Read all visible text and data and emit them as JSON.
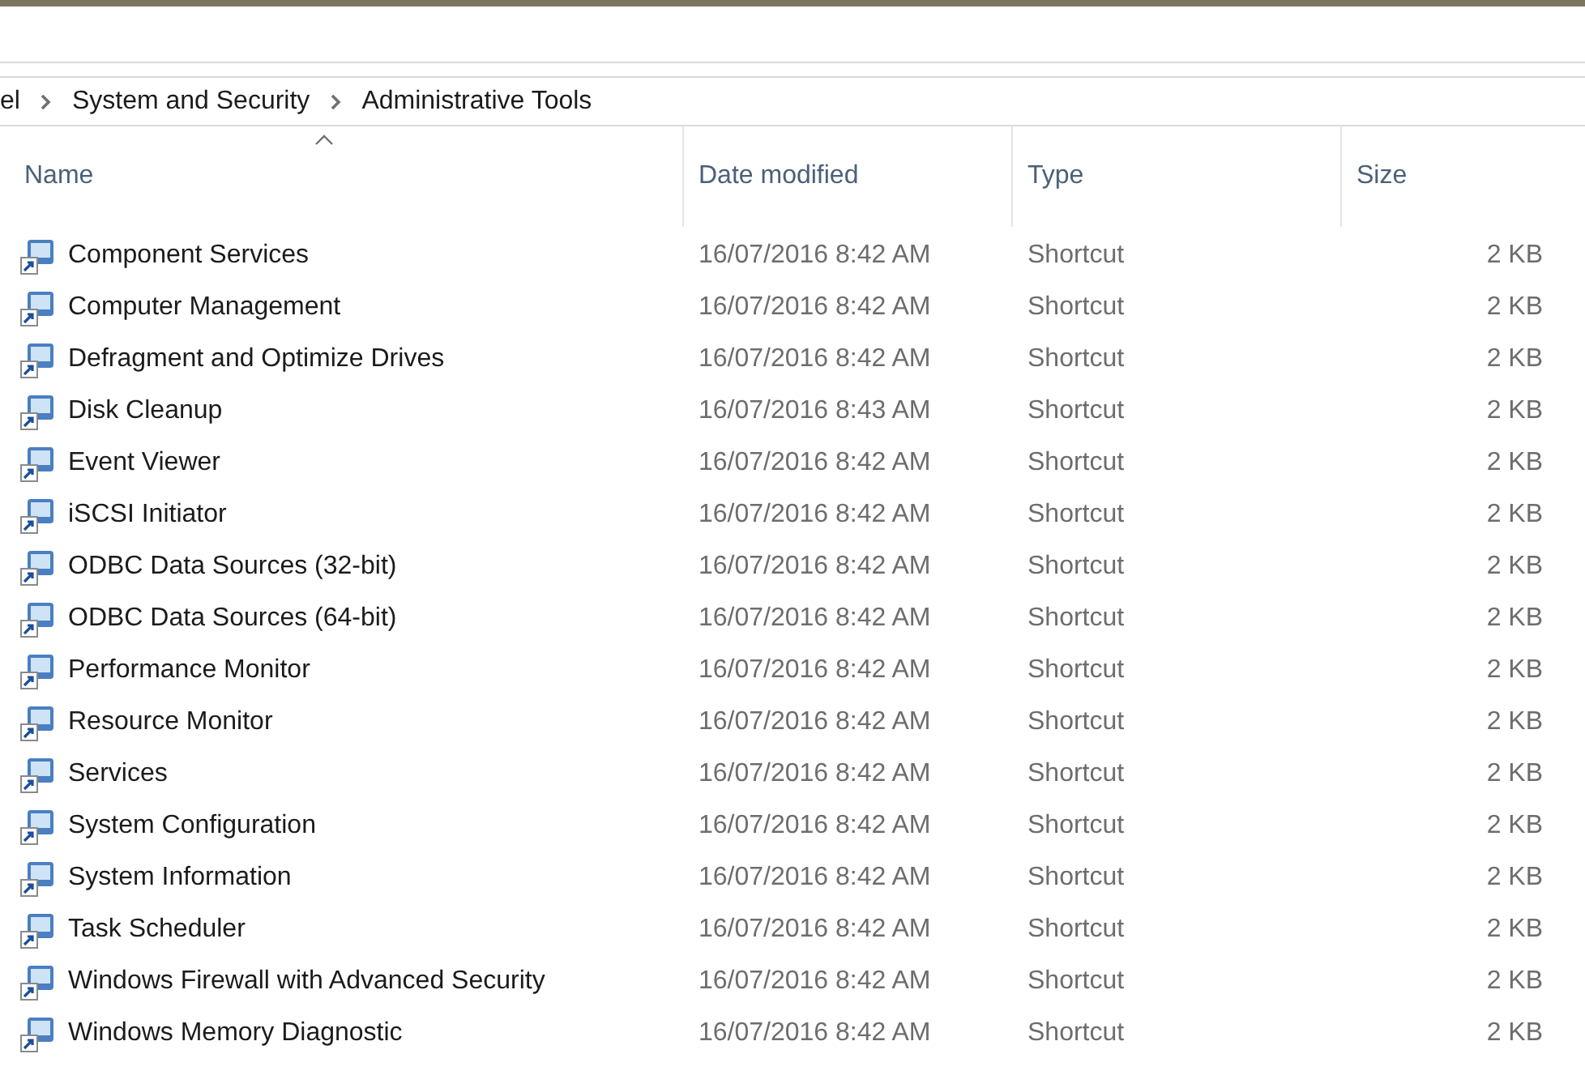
{
  "breadcrumb": [
    "el",
    "System and Security",
    "Administrative Tools"
  ],
  "table": {
    "columns": [
      {
        "label": "Name",
        "sorted": true
      },
      {
        "label": "Date modified",
        "sorted": false
      },
      {
        "label": "Type",
        "sorted": false
      },
      {
        "label": "Size",
        "sorted": false
      }
    ],
    "rows": [
      {
        "name": "Component Services",
        "date": "16/07/2016 8:42 AM",
        "type": "Shortcut",
        "size": "2 KB"
      },
      {
        "name": "Computer Management",
        "date": "16/07/2016 8:42 AM",
        "type": "Shortcut",
        "size": "2 KB"
      },
      {
        "name": "Defragment and Optimize Drives",
        "date": "16/07/2016 8:42 AM",
        "type": "Shortcut",
        "size": "2 KB"
      },
      {
        "name": "Disk Cleanup",
        "date": "16/07/2016 8:43 AM",
        "type": "Shortcut",
        "size": "2 KB"
      },
      {
        "name": "Event Viewer",
        "date": "16/07/2016 8:42 AM",
        "type": "Shortcut",
        "size": "2 KB"
      },
      {
        "name": "iSCSI Initiator",
        "date": "16/07/2016 8:42 AM",
        "type": "Shortcut",
        "size": "2 KB"
      },
      {
        "name": "ODBC Data Sources (32-bit)",
        "date": "16/07/2016 8:42 AM",
        "type": "Shortcut",
        "size": "2 KB"
      },
      {
        "name": "ODBC Data Sources (64-bit)",
        "date": "16/07/2016 8:42 AM",
        "type": "Shortcut",
        "size": "2 KB"
      },
      {
        "name": "Performance Monitor",
        "date": "16/07/2016 8:42 AM",
        "type": "Shortcut",
        "size": "2 KB"
      },
      {
        "name": "Resource Monitor",
        "date": "16/07/2016 8:42 AM",
        "type": "Shortcut",
        "size": "2 KB"
      },
      {
        "name": "Services",
        "date": "16/07/2016 8:42 AM",
        "type": "Shortcut",
        "size": "2 KB"
      },
      {
        "name": "System Configuration",
        "date": "16/07/2016 8:42 AM",
        "type": "Shortcut",
        "size": "2 KB"
      },
      {
        "name": "System Information",
        "date": "16/07/2016 8:42 AM",
        "type": "Shortcut",
        "size": "2 KB"
      },
      {
        "name": "Task Scheduler",
        "date": "16/07/2016 8:42 AM",
        "type": "Shortcut",
        "size": "2 KB"
      },
      {
        "name": "Windows Firewall with Advanced Security",
        "date": "16/07/2016 8:42 AM",
        "type": "Shortcut",
        "size": "2 KB"
      },
      {
        "name": "Windows Memory Diagnostic",
        "date": "16/07/2016 8:42 AM",
        "type": "Shortcut",
        "size": "2 KB"
      }
    ]
  }
}
